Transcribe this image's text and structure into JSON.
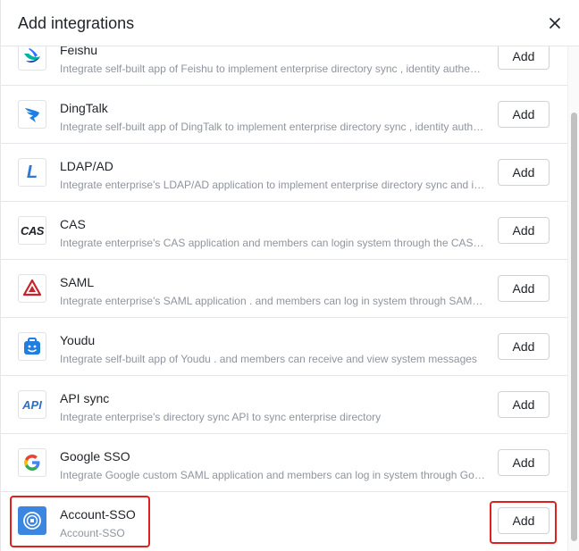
{
  "dialog": {
    "title": "Add integrations",
    "close_symbol": "×"
  },
  "add_label": "Add",
  "integrations": [
    {
      "name": "Feishu",
      "icon": "feishu-icon",
      "description": "Integrate self-built app of Feishu to implement enterprise directory sync , identity authentication and message notification"
    },
    {
      "name": "DingTalk",
      "icon": "dingtalk-icon",
      "description": "Integrate self-built app of DingTalk to implement enterprise directory sync , identity authentication and message notification"
    },
    {
      "name": "LDAP/AD",
      "icon": "ldap-icon",
      "icon_text": "L",
      "description": "Integrate enterprise's LDAP/AD application to implement enterprise directory sync and identity authentication"
    },
    {
      "name": "CAS",
      "icon": "cas-icon",
      "icon_text": "CAS",
      "description": "Integrate enterprise's CAS application and members can login system through the CAS account"
    },
    {
      "name": "SAML",
      "icon": "saml-icon",
      "description": "Integrate enterprise's SAML application . and members can log in system through SAML account"
    },
    {
      "name": "Youdu",
      "icon": "youdu-icon",
      "description": "Integrate self-built app of Youdu . and members can receive and view system messages"
    },
    {
      "name": "API sync",
      "icon": "api-icon",
      "icon_text": "API",
      "description": "Integrate enterprise's directory sync API to sync enterprise directory"
    },
    {
      "name": "Google SSO",
      "icon": "google-icon",
      "description": "Integrate Google custom SAML application and members can log in system through Google account"
    },
    {
      "name": "Account-SSO",
      "icon": "account-sso-icon",
      "description": "Account-SSO"
    }
  ],
  "colors": {
    "highlight": "#e0201e",
    "account_sso_blue": "#3b86e0",
    "youdu_blue": "#1e7fe0",
    "ldap_blue": "#2f78d4",
    "api_blue": "#2a6fc9",
    "saml_red": "#c8232c"
  }
}
